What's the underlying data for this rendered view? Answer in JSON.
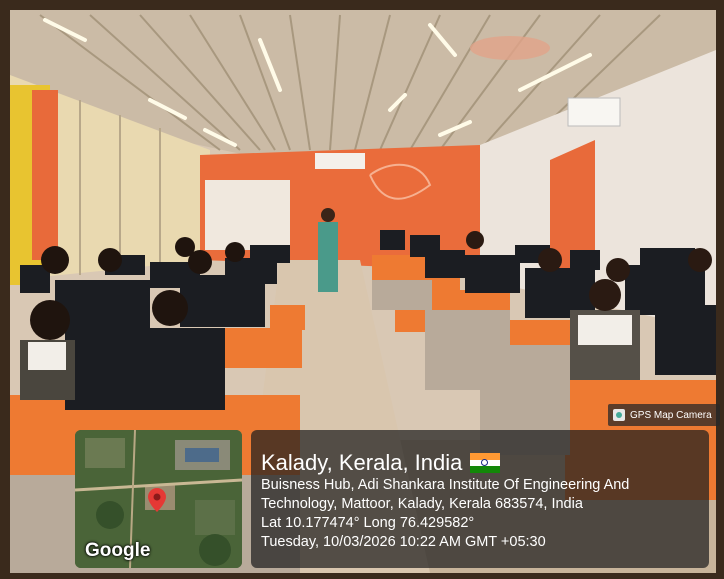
{
  "gps_camera": {
    "label": "GPS Map Camera",
    "icon": "gps-camera-icon"
  },
  "map": {
    "brand": "Google",
    "marker_icon": "map-pin-icon",
    "marker_color": "#e53935"
  },
  "location": {
    "city_line": "Kalady, Kerala, India",
    "flag": "india-flag-icon",
    "address_line_1": "Buisness Hub, Adi Shankara Institute Of Engineering And",
    "address_line_2": "Technology, Mattoor, Kalady, Kerala 683574, India",
    "coords": "Lat 10.177474° Long 76.429582°",
    "datetime": "Tuesday, 10/03/2026 10:22 AM GMT +05:30"
  },
  "photo": {
    "scene": "computer-lab",
    "colors": {
      "wall": "#e8683a",
      "desk": "#ee7a32",
      "ceiling": "#c9b9a3",
      "monitor": "#1b1d22"
    }
  }
}
